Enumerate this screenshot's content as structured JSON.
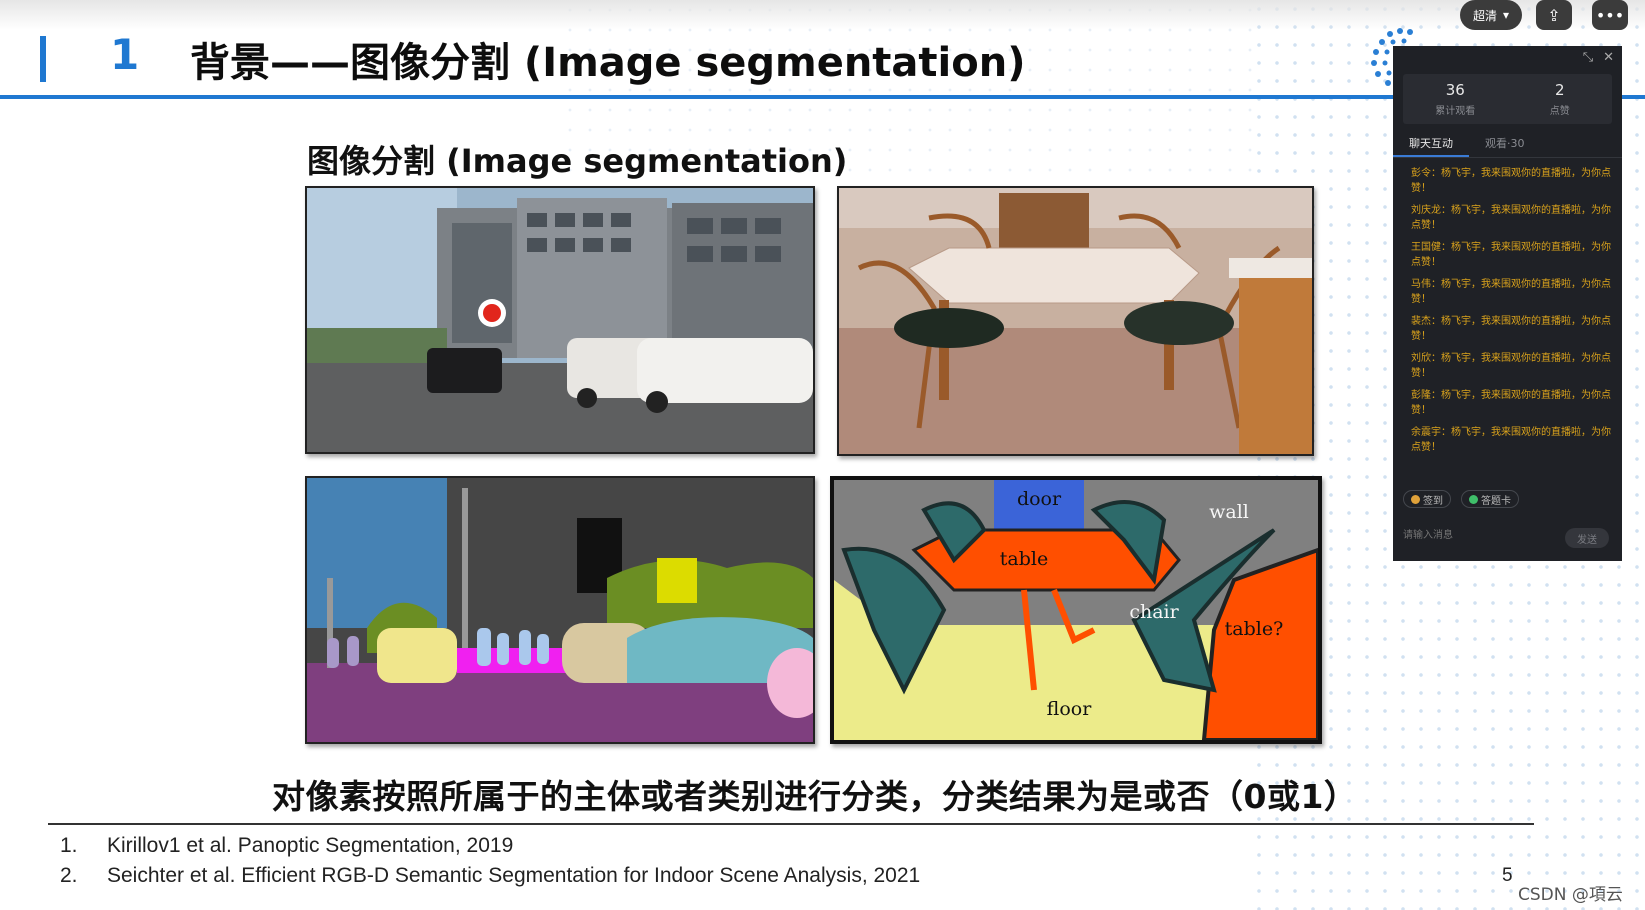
{
  "slide": {
    "title_number": "1",
    "title": "背景——图像分割 (Image segmentation)",
    "heading": "图像分割 (Image segmentation)",
    "caption": "对像素按照所属于的主体或者类别进行分类，分类结果为是或否（0或1）",
    "references": [
      {
        "num": "1.",
        "text": "Kirillov1 et al. Panoptic Segmentation, 2019"
      },
      {
        "num": "2.",
        "text": "Seichter et al. Efficient RGB-D Semantic Segmentation for Indoor Scene Analysis, 2021"
      }
    ],
    "page_number": "5",
    "segmentation_labels": {
      "door": "door",
      "wall": "wall",
      "table": "table",
      "chair": "chair",
      "table_q": "table?",
      "floor": "floor"
    }
  },
  "player": {
    "quality_label": "超清",
    "watermark": "CSDN @項云"
  },
  "chat_panel": {
    "stats": [
      {
        "value": "36",
        "label": "累计观看"
      },
      {
        "value": "2",
        "label": "点赞"
      }
    ],
    "tabs": [
      {
        "label": "聊天互动",
        "active": true
      },
      {
        "label": "观看·30",
        "active": false
      }
    ],
    "messages": [
      "彭令：杨飞宇，我来围观你的直播啦，为你点赞！",
      "刘庆龙：杨飞宇，我来围观你的直播啦，为你点赞！",
      "王国健：杨飞宇，我来围观你的直播啦，为你点赞！",
      "马伟：杨飞宇，我来围观你的直播啦，为你点赞！",
      "裴杰：杨飞宇，我来围观你的直播啦，为你点赞！",
      "刘欣：杨飞宇，我来围观你的直播啦，为你点赞！",
      "彭隆：杨飞宇，我来围观你的直播啦，为你点赞！",
      "余震宇：杨飞宇，我来围观你的直播啦，为你点赞！"
    ],
    "actions": {
      "checkin": "签到",
      "answer_card": "答题卡"
    },
    "input_placeholder": "请输入消息",
    "send_label": "发送"
  },
  "colors": {
    "accent": "#1f78d1",
    "chat_bg": "#1f2126",
    "message": "#d9a21c"
  }
}
